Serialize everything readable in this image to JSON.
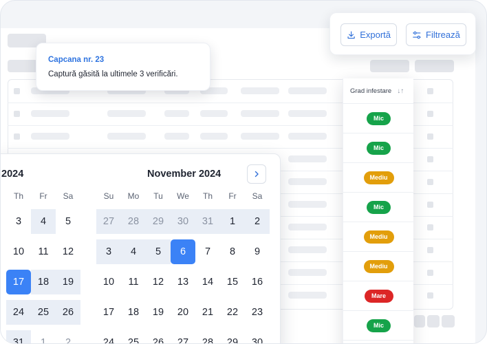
{
  "toolbar": {
    "export_label": "Exportă",
    "filter_label": "Filtrează"
  },
  "tooltip": {
    "title": "Capcana nr. 23",
    "body": "Captură găsită la ultimele 3 verificări."
  },
  "grade_column": {
    "header": "Grad infestare",
    "sort_icon": "↓↑",
    "rows": [
      {
        "label": "Mic",
        "level": "low"
      },
      {
        "label": "Mic",
        "level": "low"
      },
      {
        "label": "Mediu",
        "level": "medium"
      },
      {
        "label": "Mic",
        "level": "low"
      },
      {
        "label": "Mediu",
        "level": "medium"
      },
      {
        "label": "Mediu",
        "level": "medium"
      },
      {
        "label": "Mare",
        "level": "high"
      },
      {
        "label": "Mic",
        "level": "low"
      }
    ],
    "colors": {
      "low": "#16a34a",
      "medium": "#e29e0b",
      "high": "#dc2626"
    }
  },
  "calendar": {
    "left_month": "2024",
    "right_month": "November 2024",
    "left_weekdays": [
      "Th",
      "Fr",
      "Sa"
    ],
    "right_weekdays": [
      "Su",
      "Mo",
      "Tu",
      "We",
      "Th",
      "Fr",
      "Sa"
    ],
    "left_days": [
      [
        "3",
        "4",
        "5"
      ],
      [
        "10",
        "11",
        "12"
      ],
      [
        "17",
        "18",
        "19"
      ],
      [
        "24",
        "25",
        "26"
      ],
      [
        "31",
        "1",
        "2"
      ]
    ],
    "right_days": [
      [
        "27",
        "28",
        "29",
        "30",
        "31",
        "1",
        "2"
      ],
      [
        "3",
        "4",
        "5",
        "6",
        "7",
        "8",
        "9"
      ],
      [
        "10",
        "11",
        "12",
        "13",
        "14",
        "15",
        "16"
      ],
      [
        "17",
        "18",
        "19",
        "20",
        "21",
        "22",
        "23"
      ],
      [
        "24",
        "25",
        "26",
        "27",
        "28",
        "29",
        "30"
      ]
    ],
    "accent": "#3b82f6"
  }
}
